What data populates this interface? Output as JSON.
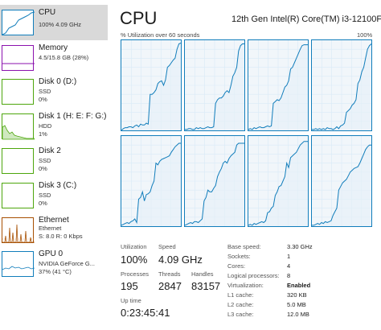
{
  "sidebar": {
    "items": [
      {
        "title": "CPU",
        "sub1": "100% 4.09 GHz",
        "sub2": "",
        "sub3": "",
        "color": "#117dbb"
      },
      {
        "title": "Memory",
        "sub1": "4.5/15.8 GB (28%)",
        "sub2": "",
        "sub3": "",
        "color": "#8b12ae"
      },
      {
        "title": "Disk 0 (D:)",
        "sub1": "SSD",
        "sub2": "0%",
        "sub3": "",
        "color": "#4da60c"
      },
      {
        "title": "Disk 1 (H: E: F: G:)",
        "sub1": "HDD",
        "sub2": "1%",
        "sub3": "",
        "color": "#4da60c"
      },
      {
        "title": "Disk 2",
        "sub1": "SSD",
        "sub2": "0%",
        "sub3": "",
        "color": "#4da60c"
      },
      {
        "title": "Disk 3 (C:)",
        "sub1": "SSD",
        "sub2": "0%",
        "sub3": "",
        "color": "#4da60c"
      },
      {
        "title": "Ethernet",
        "sub1": "Ethernet",
        "sub2": "S: 8.0  R: 0 Kbps",
        "sub3": "",
        "color": "#a74f01"
      },
      {
        "title": "GPU 0",
        "sub1": "NVIDIA GeForce G...",
        "sub2": "37% (41 °C)",
        "sub3": "",
        "color": "#117dbb"
      }
    ]
  },
  "main": {
    "title": "CPU",
    "model": "12th Gen Intel(R) Core(TM) i3-12100F",
    "util_label": "% Utilization over 60 seconds",
    "util_max": "100%",
    "graph_color": "#117dbb"
  },
  "stats": {
    "utilization_label": "Utilization",
    "utilization_value": "100%",
    "speed_label": "Speed",
    "speed_value": "4.09 GHz",
    "processes_label": "Processes",
    "processes_value": "195",
    "threads_label": "Threads",
    "threads_value": "2847",
    "handles_label": "Handles",
    "handles_value": "83157",
    "uptime_label": "Up time",
    "uptime_value": "0:23:45:41"
  },
  "specs": [
    {
      "key": "Base speed:",
      "value": "3.30 GHz"
    },
    {
      "key": "Sockets:",
      "value": "1"
    },
    {
      "key": "Cores:",
      "value": "4"
    },
    {
      "key": "Logical processors:",
      "value": "8"
    },
    {
      "key": "Virtualization:",
      "value": "Enabled"
    },
    {
      "key": "L1 cache:",
      "value": "320 KB"
    },
    {
      "key": "L2 cache:",
      "value": "5.0 MB"
    },
    {
      "key": "L3 cache:",
      "value": "12.0 MB"
    }
  ]
}
